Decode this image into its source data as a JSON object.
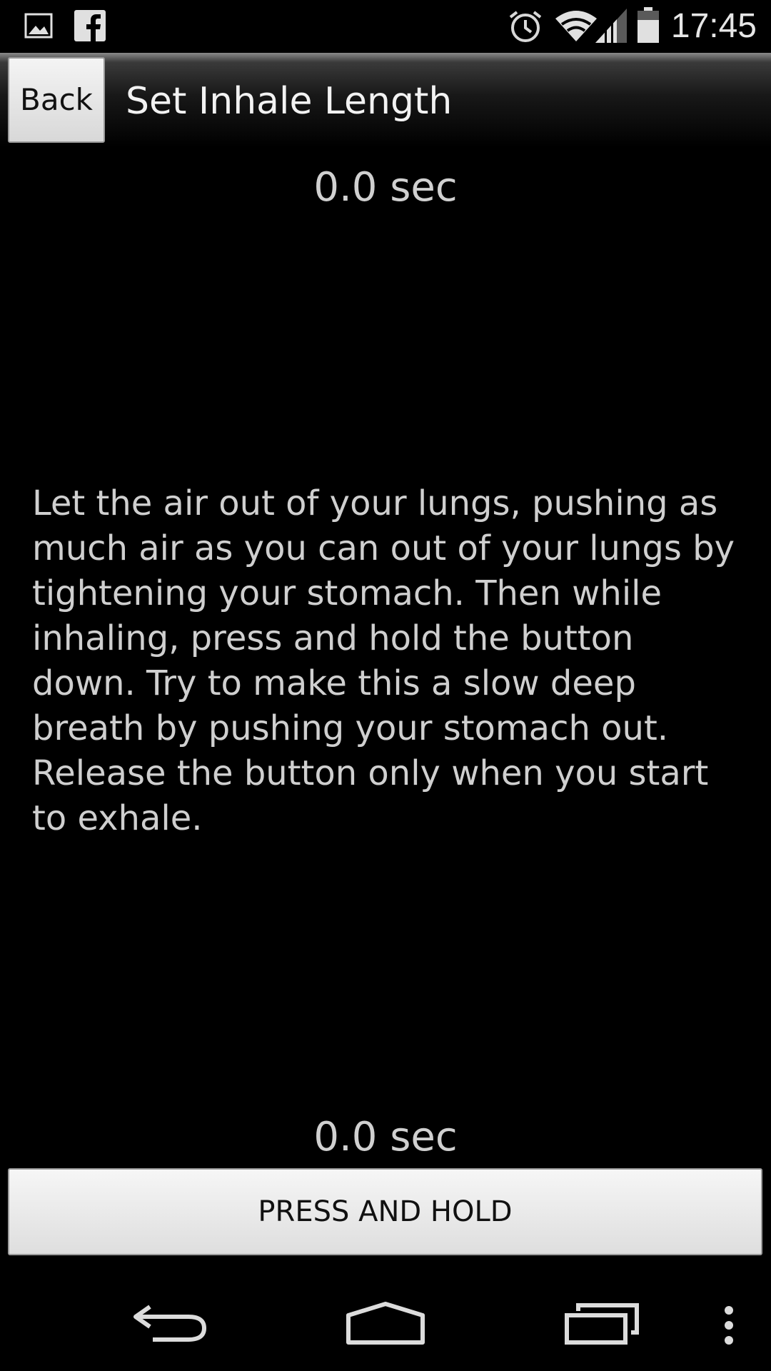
{
  "status_bar": {
    "left_icons": [
      "gallery-icon",
      "facebook-icon"
    ],
    "right_icons": [
      "alarm-icon",
      "wifi-icon",
      "signal-icon",
      "battery-icon"
    ],
    "time": "17:45"
  },
  "action_bar": {
    "back_label": "Back",
    "title": "Set Inhale Length"
  },
  "main": {
    "top_timer": "0.0 sec",
    "instructions": "Let the air out of your lungs, pushing as much air as you can out of your lungs by tightening your stomach. Then while inhaling, press and hold the button down. Try to make this a slow deep breath by pushing your stomach out. Release the button only when you start to exhale.",
    "bottom_timer": "0.0 sec",
    "hold_button_label": "PRESS AND HOLD"
  },
  "nav_bar": {
    "buttons": [
      "back-nav-icon",
      "home-nav-icon",
      "recents-nav-icon",
      "overflow-menu-icon"
    ]
  },
  "colors": {
    "background": "#000000",
    "text": "#d0d0d0",
    "button_face": "#e8e8e8",
    "button_text": "#111111"
  }
}
